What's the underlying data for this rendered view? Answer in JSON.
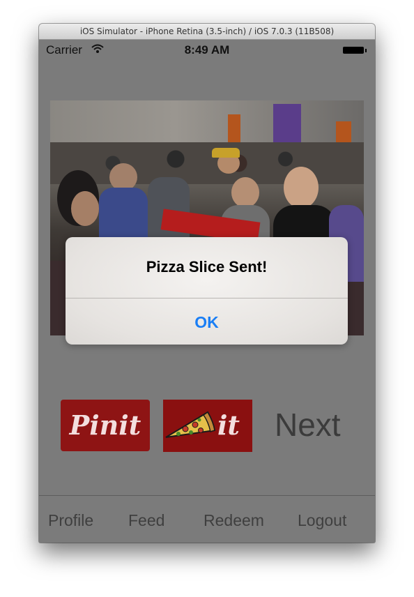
{
  "window": {
    "title": "iOS Simulator - iPhone Retina (3.5-inch) / iOS 7.0.3 (11B508)"
  },
  "status_bar": {
    "carrier": "Carrier",
    "time": "8:49 AM"
  },
  "actions": {
    "pin_label": "Pinit",
    "pizza_label": "it",
    "next_label": "Next"
  },
  "tabs": [
    "Profile",
    "Feed",
    "Redeem",
    "Logout"
  ],
  "alert": {
    "title": "Pizza Slice Sent!",
    "button": "OK"
  },
  "colors": {
    "accent": "#1a7ef5",
    "pin_red": "#8e1414"
  }
}
